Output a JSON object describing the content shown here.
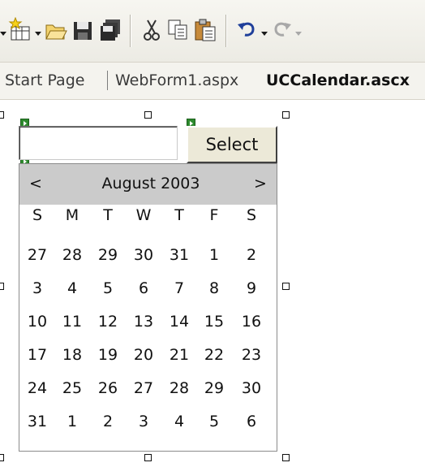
{
  "toolbar": {
    "buttons": [
      {
        "name": "new-project-icon",
        "has_dropdown": true
      },
      {
        "name": "add-item-icon",
        "has_dropdown": true
      },
      {
        "name": "open-file-icon"
      },
      {
        "name": "save-icon"
      },
      {
        "name": "save-all-icon"
      },
      {
        "name": "cut-icon"
      },
      {
        "name": "copy-icon"
      },
      {
        "name": "paste-icon"
      },
      {
        "name": "undo-icon",
        "has_dropdown": true
      },
      {
        "name": "redo-icon"
      }
    ]
  },
  "tabs": [
    {
      "label": "Start Page",
      "active": false
    },
    {
      "label": "WebForm1.aspx",
      "active": false
    },
    {
      "label": "UCCalendar.ascx",
      "active": true
    }
  ],
  "designer": {
    "textbox_value": "",
    "select_button_label": "Select",
    "calendar": {
      "prev_label": "<",
      "next_label": ">",
      "month_title": "August 2003",
      "day_headers": [
        "S",
        "M",
        "T",
        "W",
        "T",
        "F",
        "S"
      ],
      "weeks": [
        [
          "27",
          "28",
          "29",
          "30",
          "31",
          "1",
          "2"
        ],
        [
          "3",
          "4",
          "5",
          "6",
          "7",
          "8",
          "9"
        ],
        [
          "10",
          "11",
          "12",
          "13",
          "14",
          "15",
          "16"
        ],
        [
          "17",
          "18",
          "19",
          "20",
          "21",
          "22",
          "23"
        ],
        [
          "24",
          "25",
          "26",
          "27",
          "28",
          "29",
          "30"
        ],
        [
          "31",
          "1",
          "2",
          "3",
          "4",
          "5",
          "6"
        ]
      ]
    }
  }
}
